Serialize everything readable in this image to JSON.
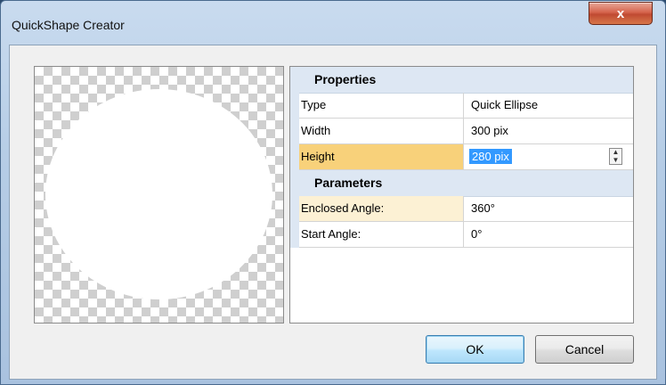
{
  "window": {
    "title": "QuickShape Creator",
    "close_glyph": "x"
  },
  "properties": {
    "category_properties": "Properties",
    "category_parameters": "Parameters",
    "rows": [
      {
        "name": "Type",
        "value": "Quick Ellipse"
      },
      {
        "name": "Width",
        "value": "300 pix"
      },
      {
        "name": "Height",
        "value": "280 pix"
      },
      {
        "name": "Enclosed Angle:",
        "value": "360°"
      },
      {
        "name": "Start Angle:",
        "value": "0°"
      }
    ],
    "spin_up": "▲",
    "spin_down": "▼"
  },
  "buttons": {
    "ok": "OK",
    "cancel": "Cancel"
  },
  "colors": {
    "selected_row": "#f8d17a",
    "selection_text_bg": "#3399ff",
    "category_bg": "#dde7f3"
  }
}
